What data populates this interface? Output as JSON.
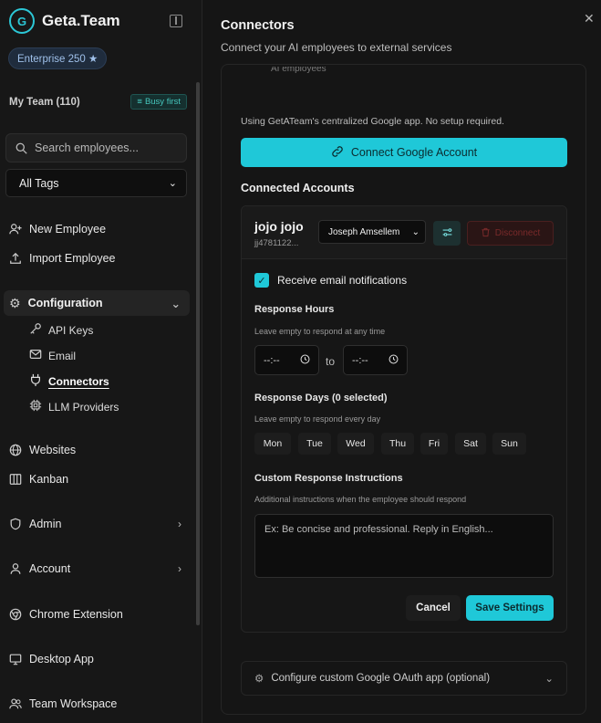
{
  "app": {
    "name": "Geta.Team",
    "logo_text": "G",
    "plan_badge": "Enterprise 250 ★"
  },
  "team": {
    "label": "My Team (110)",
    "sort_badge": "Busy first"
  },
  "search": {
    "placeholder": "Search employees..."
  },
  "tags": {
    "selected": "All Tags"
  },
  "nav": {
    "new_employee": "New Employee",
    "import_employee": "Import Employee",
    "configuration": "Configuration",
    "config_items": [
      "API Keys",
      "Email",
      "Connectors",
      "LLM Providers"
    ],
    "websites": "Websites",
    "kanban": "Kanban",
    "admin": "Admin",
    "account": "Account",
    "chrome_extension": "Chrome Extension",
    "desktop_app": "Desktop App",
    "team_workspace": "Team Workspace"
  },
  "panel": {
    "title": "Connectors",
    "subtitle": "Connect your AI employees to external services",
    "cut_text": "AI employees",
    "info": "Using GetATeam's centralized Google app. No setup required.",
    "connect_button": "Connect Google Account",
    "connected_accounts": "Connected Accounts"
  },
  "account": {
    "name": "jojo jojo",
    "email": "jj4781122...",
    "employee": "Joseph Amsellem",
    "disconnect": "Disconnect",
    "email_notifications": "Receive email notifications",
    "response_hours_title": "Response Hours",
    "response_hours_hint": "Leave empty to respond at any time",
    "time_from": "--:--",
    "time_to": "--:--",
    "to_label": "to",
    "response_days_title": "Response Days (0 selected)",
    "response_days_hint": "Leave empty to respond every day",
    "days": [
      "Mon",
      "Tue",
      "Wed",
      "Thu",
      "Fri",
      "Sat",
      "Sun"
    ],
    "instructions_title": "Custom Response Instructions",
    "instructions_hint": "Additional instructions when the employee should respond",
    "instructions_placeholder": "Ex: Be concise and professional. Reply in English...",
    "cancel": "Cancel",
    "save": "Save Settings"
  },
  "oauth": {
    "label": "Configure custom Google OAuth app (optional)"
  },
  "colors": {
    "accent": "#1fc8d8",
    "background": "#141414",
    "danger": "#7a2a2a"
  }
}
